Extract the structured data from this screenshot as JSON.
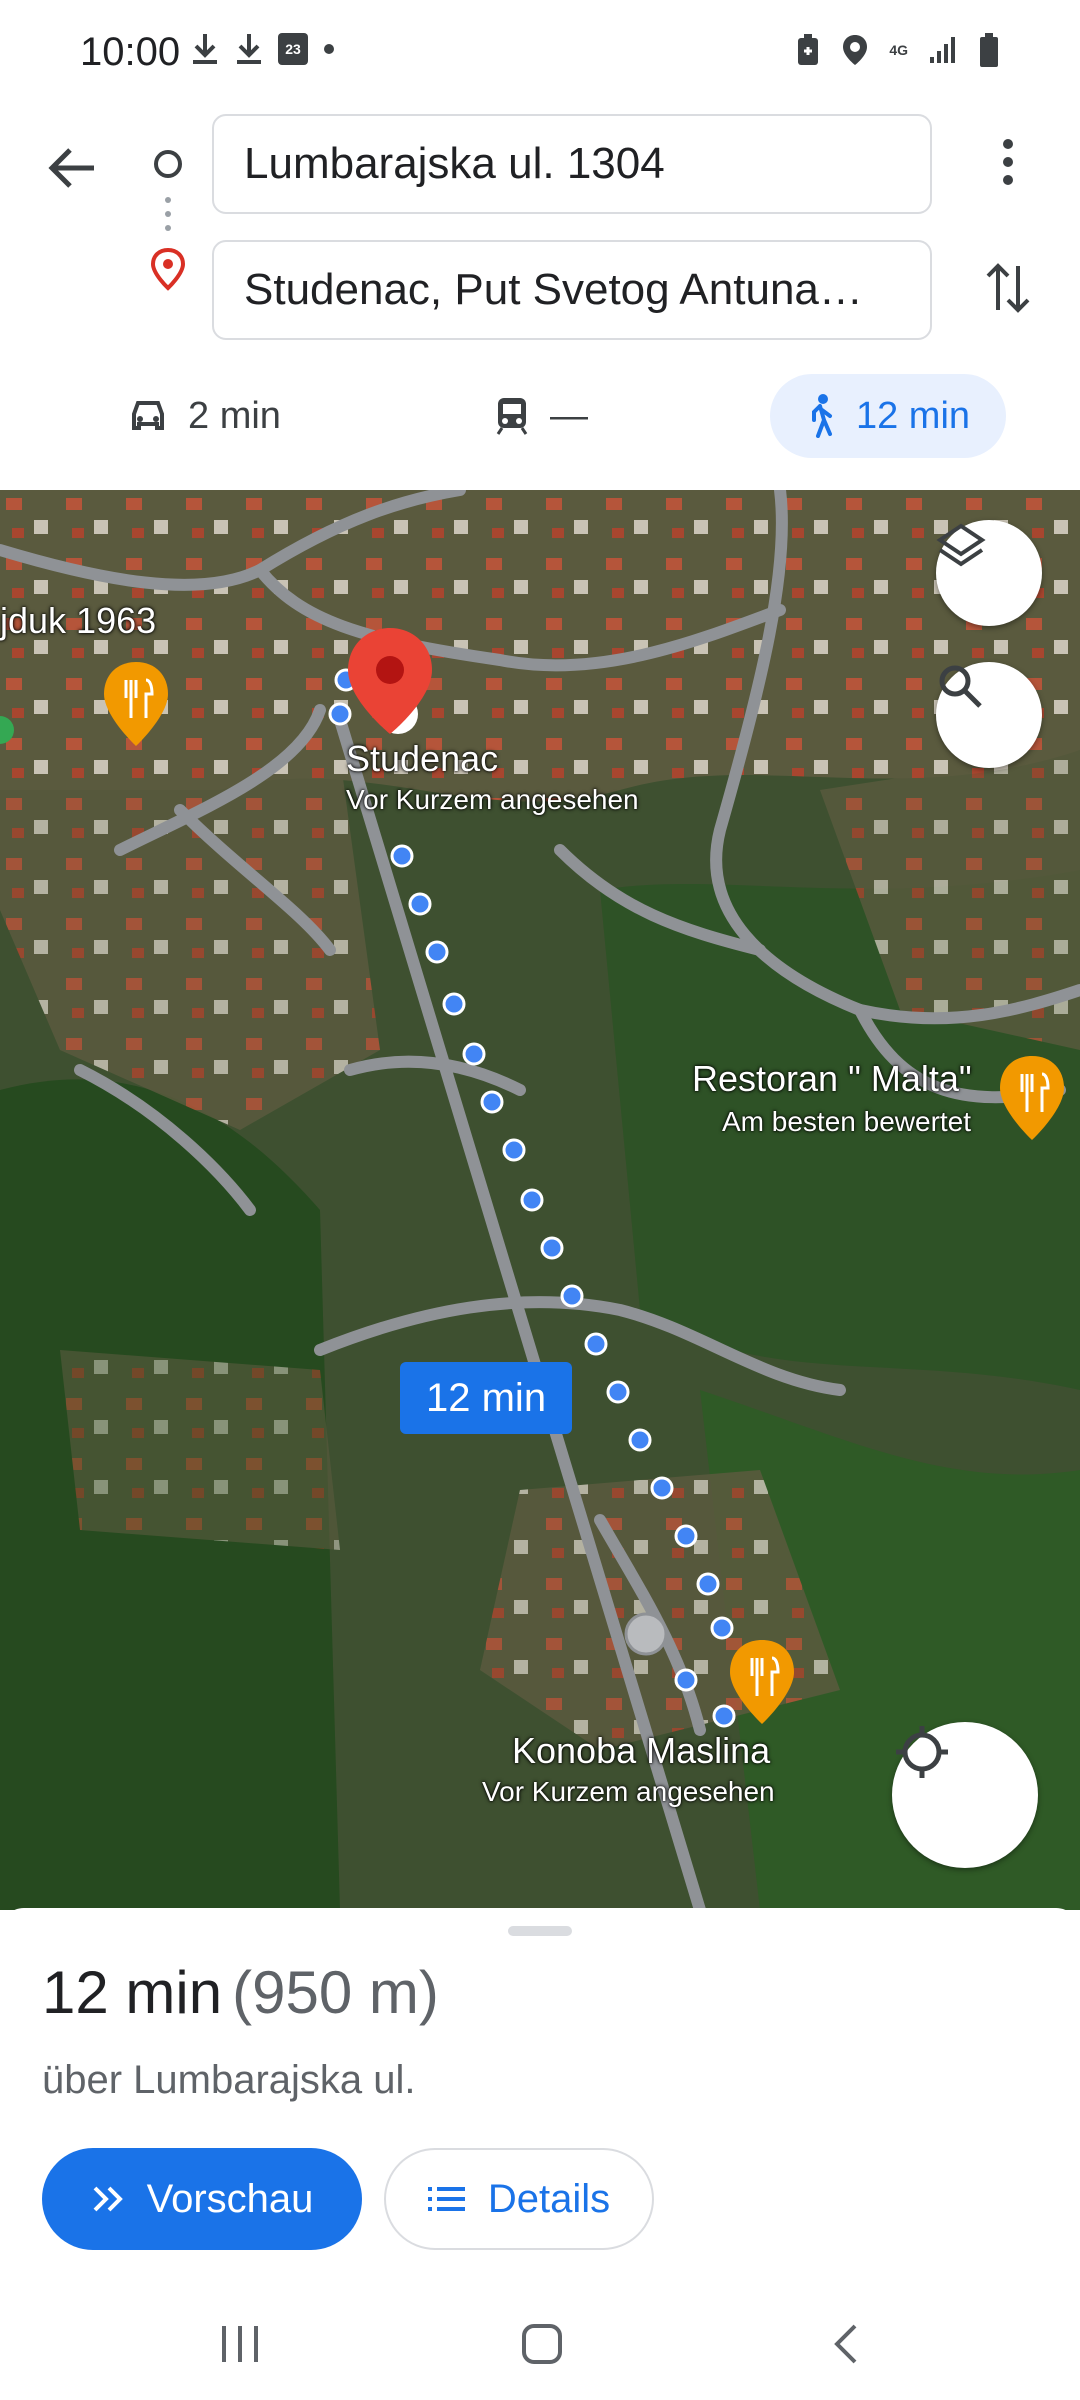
{
  "status": {
    "time": "10:00",
    "calendar_day": "23",
    "network": "4G",
    "icons": [
      "download-icon",
      "download-icon",
      "calendar-icon",
      "dot-icon",
      "battery-saver-icon",
      "location-icon",
      "network-4g-icon",
      "signal-icon",
      "battery-icon"
    ]
  },
  "directions": {
    "origin": "Lumbarajska ul. 1304",
    "destination": "Studenac, Put Svetog Antuna…"
  },
  "modes": [
    {
      "name": "drive",
      "icon": "car-icon",
      "label": "2 min"
    },
    {
      "name": "transit",
      "icon": "train-icon",
      "label": "—"
    },
    {
      "name": "walk",
      "icon": "walk-icon",
      "label": "12 min",
      "selected": true
    }
  ],
  "map": {
    "labels": {
      "poi_partial": "jduk 1963",
      "dest_name": "Studenac",
      "dest_sub": "Vor Kurzem angesehen",
      "rest_name": "Restoran \" Malta\"",
      "rest_sub": "Am besten bewertet",
      "konoba_name": "Konoba Maslina",
      "konoba_sub": "Vor Kurzem angesehen"
    },
    "route_duration": "12 min",
    "colors": {
      "route": "#4285f4",
      "accent": "#1a73e8",
      "poi": "#f29900",
      "pin": "#ea4335"
    }
  },
  "sheet": {
    "duration": "12 min",
    "distance": "(950 m)",
    "via": "über Lumbarajska ul.",
    "preview_label": "Vorschau",
    "details_label": "Details"
  }
}
